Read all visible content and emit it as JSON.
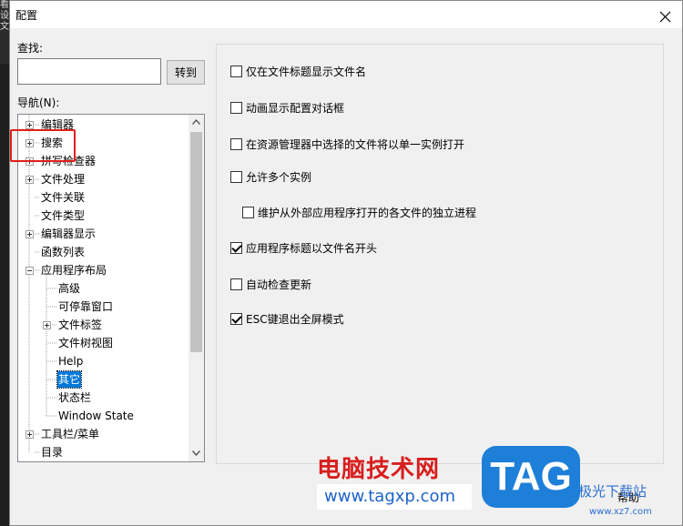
{
  "edge": {
    "chars": [
      "看",
      "设",
      "文"
    ]
  },
  "dialog": {
    "title": "配置",
    "find_label": "查找:",
    "find_value": "",
    "goto_label": "转到",
    "nav_label": "导航(N):",
    "help_label": "帮助"
  },
  "tree": {
    "items": [
      {
        "label": "编辑器",
        "expander": "plus"
      },
      {
        "label": "搜索",
        "expander": "plus"
      },
      {
        "label": "拼写检查器",
        "expander": "plus"
      },
      {
        "label": "文件处理",
        "expander": "plus"
      },
      {
        "label": "文件关联",
        "expander": "none"
      },
      {
        "label": "文件类型",
        "expander": "none"
      },
      {
        "label": "编辑器显示",
        "expander": "plus"
      },
      {
        "label": "函数列表",
        "expander": "none"
      },
      {
        "label": "应用程序布局",
        "expander": "minus"
      },
      {
        "label": "高级",
        "expander": "none"
      },
      {
        "label": "可停靠窗口",
        "expander": "none"
      },
      {
        "label": "文件标签",
        "expander": "plus"
      },
      {
        "label": "文件树视图",
        "expander": "none"
      },
      {
        "label": "Help",
        "expander": "none"
      },
      {
        "label": "其它",
        "expander": "none",
        "selected": true
      },
      {
        "label": "状态栏",
        "expander": "none"
      },
      {
        "label": "Window State",
        "expander": "none"
      },
      {
        "label": "工具栏/菜单",
        "expander": "plus"
      },
      {
        "label": "目录",
        "expander": "none"
      }
    ]
  },
  "options": [
    {
      "label": "仅在文件标题显示文件名",
      "checked": false
    },
    {
      "label": "动画显示配置对话框",
      "checked": false
    },
    {
      "label": "在资源管理器中选择的文件将以单一实例打开",
      "checked": false
    },
    {
      "label": "允许多个实例",
      "checked": false
    },
    {
      "label": "维护从外部应用程序打开的各文件的独立进程",
      "checked": false
    },
    {
      "label": "应用程序标题以文件名开头",
      "checked": true
    },
    {
      "label": "自动检查更新",
      "checked": false
    },
    {
      "label": "ESC键退出全屏模式",
      "checked": true
    }
  ],
  "watermark": {
    "title": "电脑技术网",
    "url": "www.tagxp.com",
    "logo": "TAG",
    "site": "极光下载站",
    "site_url": "www.xz7.com"
  },
  "colors": {
    "selection": "#0078d7",
    "highlight_box": "#e0201a",
    "watermark_red": "#d81e1e",
    "watermark_blue": "#1e7fd8"
  }
}
